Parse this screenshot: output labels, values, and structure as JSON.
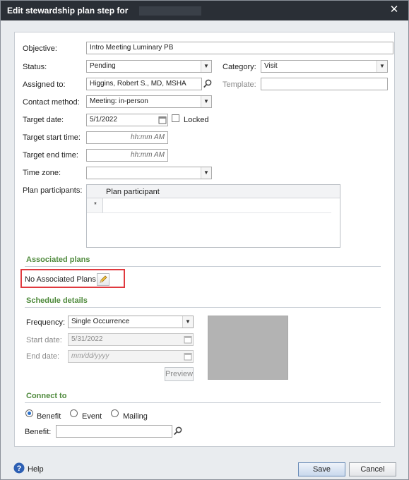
{
  "dialog": {
    "title": "Edit stewardship plan step for",
    "close_glyph": "✕"
  },
  "form": {
    "objective": {
      "label": "Objective:",
      "value": "Intro Meeting Luminary PB"
    },
    "status": {
      "label": "Status:",
      "value": "Pending"
    },
    "category": {
      "label": "Category:",
      "value": "Visit"
    },
    "assigned_to": {
      "label": "Assigned to:",
      "value": "Higgins, Robert S., MD, MSHA"
    },
    "template": {
      "label": "Template:",
      "value": ""
    },
    "contact_method": {
      "label": "Contact method:",
      "value": "Meeting: in-person"
    },
    "target_date": {
      "label": "Target date:",
      "value": "5/1/2022"
    },
    "locked": {
      "label": "Locked",
      "checked": false
    },
    "target_start_time": {
      "label": "Target start time:",
      "placeholder": "hh:mm AM"
    },
    "target_end_time": {
      "label": "Target end time:",
      "placeholder": "hh:mm AM"
    },
    "time_zone": {
      "label": "Time zone:",
      "value": ""
    },
    "plan_participants": {
      "label": "Plan participants:",
      "column_header": "Plan participant",
      "new_row_marker": "*"
    }
  },
  "associated_plans": {
    "heading": "Associated plans",
    "text": "No Associated Plans"
  },
  "schedule": {
    "heading": "Schedule details",
    "frequency": {
      "label": "Frequency:",
      "value": "Single Occurrence"
    },
    "start_date": {
      "label": "Start date:",
      "value": "5/31/2022"
    },
    "end_date": {
      "label": "End date:",
      "placeholder": "mm/dd/yyyy"
    },
    "preview_label": "Preview"
  },
  "connect_to": {
    "heading": "Connect to",
    "options": [
      "Benefit",
      "Event",
      "Mailing"
    ],
    "selected": "Benefit",
    "benefit": {
      "label": "Benefit:",
      "value": ""
    }
  },
  "footer": {
    "help_label": "Help",
    "save_label": "Save",
    "cancel_label": "Cancel"
  },
  "colors": {
    "section_heading": "#4f8a3c",
    "title_bar": "#2a2f36",
    "highlight": "#e0393e"
  }
}
